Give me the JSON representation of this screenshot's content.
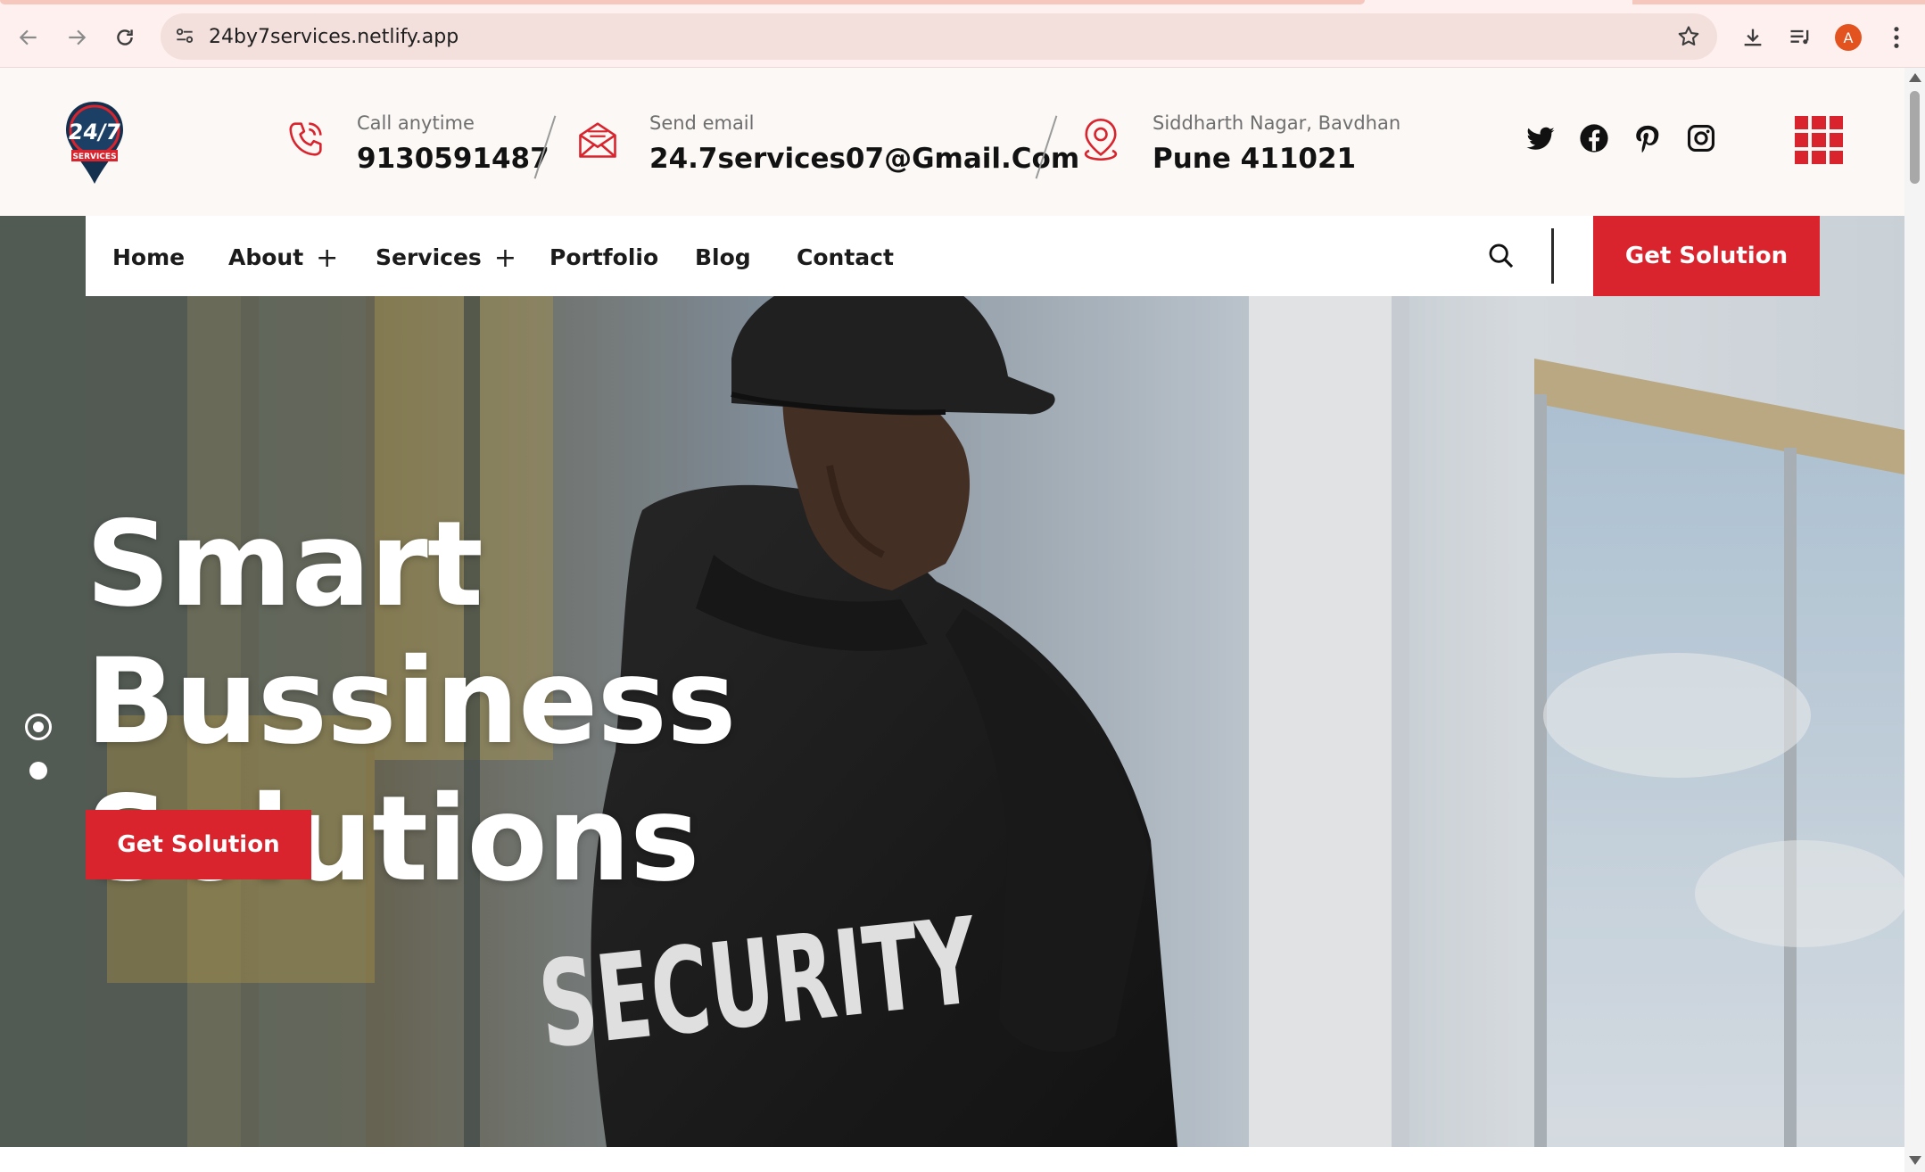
{
  "browser": {
    "url": "24by7services.netlify.app",
    "profile_initial": "A",
    "icons": [
      "back-arrow-icon",
      "forward-arrow-icon",
      "reload-icon",
      "site-settings-icon",
      "bookmark-star-icon",
      "download-icon",
      "media-control-icon",
      "kebab-menu-icon"
    ]
  },
  "header": {
    "logo_text": "24/7",
    "logo_sub": "SERVICES",
    "phone": {
      "label": "Call anytime",
      "value": "9130591487"
    },
    "email": {
      "label": "Send email",
      "value": "24.7services07@Gmail.Com"
    },
    "address": {
      "label": "Siddharth Nagar, Bavdhan",
      "value": "Pune 411021"
    },
    "social": [
      "twitter-icon",
      "facebook-icon",
      "pinterest-icon",
      "instagram-icon"
    ]
  },
  "nav": {
    "items": [
      {
        "label": "Home",
        "has_submenu": false
      },
      {
        "label": "About",
        "has_submenu": true
      },
      {
        "label": "Services",
        "has_submenu": true
      },
      {
        "label": "Portfolio",
        "has_submenu": false
      },
      {
        "label": "Blog",
        "has_submenu": false
      },
      {
        "label": "Contact",
        "has_submenu": false
      }
    ],
    "submenu_glyph": "+",
    "cta_label": "Get Solution"
  },
  "hero": {
    "title_line1": "Smart Bussiness",
    "title_line2": "Solutions",
    "cta_label": "Get Solution",
    "jacket_text": "SECURITY",
    "slides_total": 2,
    "active_slide": 1
  },
  "colors": {
    "accent": "#d9232d",
    "topbar_bg": "#fbf8f5",
    "chrome_bg": "#fdf0ee"
  }
}
